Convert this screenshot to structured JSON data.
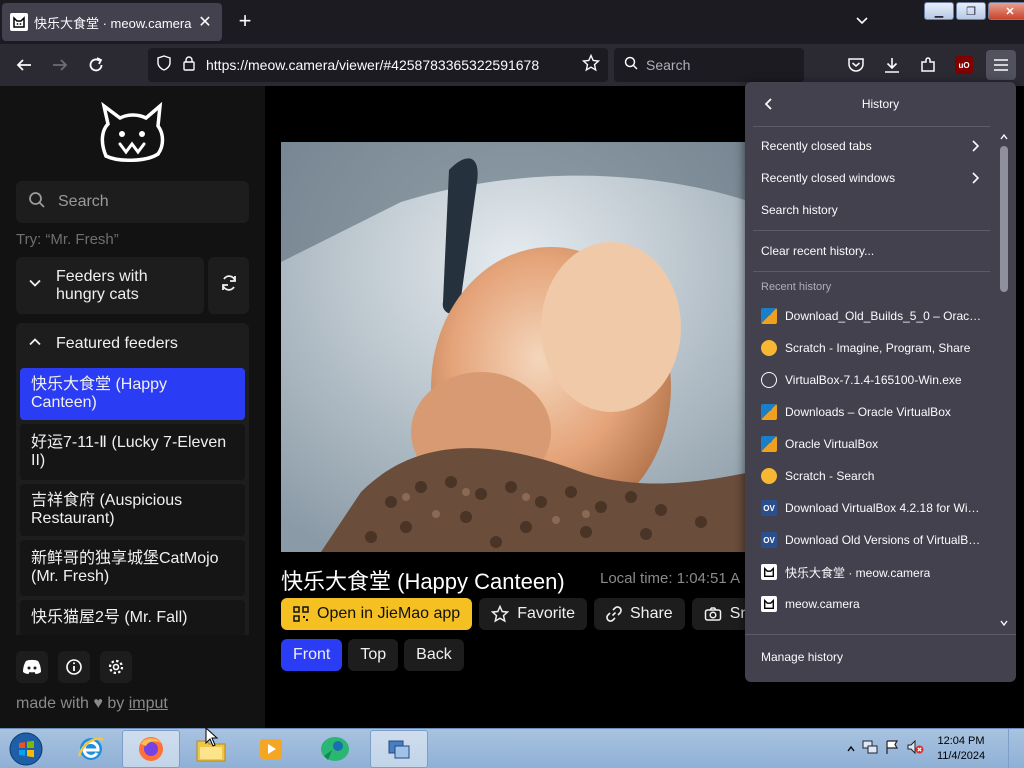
{
  "browser": {
    "tab_title": "快乐大食堂 · meow.camera",
    "url": "https://meow.camera/viewer/#4258783365322591678",
    "search_placeholder": "Search"
  },
  "sidebar": {
    "search_placeholder": "Search",
    "try_hint": "Try: “Mr. Fresh”",
    "feeders_hungry_label": "Feeders with hungry cats",
    "featured_label": "Featured feeders",
    "feeders": [
      {
        "name": "快乐大食堂 (Happy Canteen)",
        "active": true
      },
      {
        "name": "好运7-11-Ⅱ (Lucky 7-Eleven II)",
        "active": false
      },
      {
        "name": "吉祥食府 (Auspicious Restaurant)",
        "active": false
      },
      {
        "name": "新鲜哥的独享城堡CatMojo (Mr. Fresh)",
        "active": false
      },
      {
        "name": "快乐猫屋2号 (Mr. Fall)",
        "active": false
      }
    ],
    "made_with_prefix": "made with",
    "made_with_by": "by",
    "made_with_author": "imput"
  },
  "viewer": {
    "title": "快乐大食堂 (Happy Canteen)",
    "local_time": "Local time: 1:04:51 A",
    "actions": {
      "open_app": "Open in JieMao app",
      "favorite": "Favorite",
      "share": "Share",
      "snapshot": "Sn"
    },
    "views": {
      "front": "Front",
      "top": "Top",
      "back": "Back"
    }
  },
  "history": {
    "title": "History",
    "recently_closed_tabs": "Recently closed tabs",
    "recently_closed_windows": "Recently closed windows",
    "search_history": "Search history",
    "clear_recent_history": "Clear recent history...",
    "recent_history_label": "Recent history",
    "items": [
      {
        "title": "Download_Old_Builds_5_0 – Oracle ...",
        "icon": "virtualbox"
      },
      {
        "title": "Scratch - Imagine, Program, Share",
        "icon": "scratch"
      },
      {
        "title": "VirtualBox-7.1.4-165100-Win.exe",
        "icon": "globe"
      },
      {
        "title": "Downloads – Oracle VirtualBox",
        "icon": "virtualbox"
      },
      {
        "title": "Oracle VirtualBox",
        "icon": "virtualbox"
      },
      {
        "title": "Scratch - Search",
        "icon": "scratch"
      },
      {
        "title": "Download VirtualBox 4.2.18 for Win...",
        "icon": "ov"
      },
      {
        "title": "Download Old Versions of VirtualBo...",
        "icon": "ov"
      },
      {
        "title": "快乐大食堂 · meow.camera",
        "icon": "cat"
      },
      {
        "title": "meow.camera",
        "icon": "cat"
      }
    ],
    "manage_history": "Manage history"
  },
  "taskbar": {
    "time": "12:04 PM",
    "date": "11/4/2024"
  },
  "colors": {
    "accent_blue": "#2b3cf5",
    "accent_yellow": "#f5c022",
    "panel_bg": "#42414d"
  }
}
